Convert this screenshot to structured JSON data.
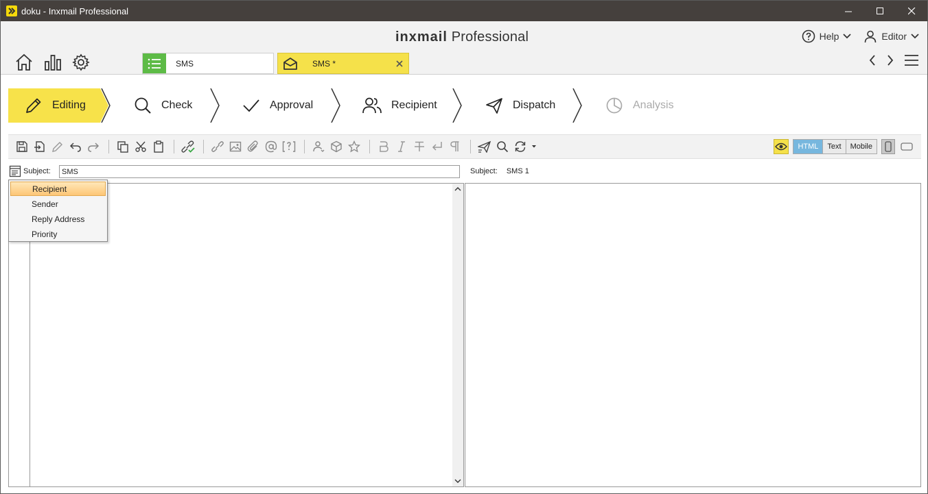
{
  "window": {
    "title": "doku - Inxmail Professional"
  },
  "header": {
    "brand_bold": "inxmail",
    "brand_rest": "Professional",
    "help_label": "Help",
    "user_label": "Editor"
  },
  "tabs": [
    {
      "label": "SMS",
      "icon": "list-icon"
    },
    {
      "label": "SMS *",
      "icon": "mail-open-icon"
    }
  ],
  "steps": [
    {
      "label": "Editing",
      "icon": "pencil-icon",
      "state": "active"
    },
    {
      "label": "Check",
      "icon": "search-icon",
      "state": "normal"
    },
    {
      "label": "Approval",
      "icon": "check-icon",
      "state": "normal"
    },
    {
      "label": "Recipient",
      "icon": "people-icon",
      "state": "normal"
    },
    {
      "label": "Dispatch",
      "icon": "paper-plane-icon",
      "state": "normal"
    },
    {
      "label": "Analysis",
      "icon": "pie-chart-icon",
      "state": "disabled"
    }
  ],
  "toolbar": {
    "view_modes": [
      "HTML",
      "Text",
      "Mobile"
    ],
    "active_view": "HTML"
  },
  "editor": {
    "subject_label": "Subject:",
    "subject_value": "SMS"
  },
  "preview": {
    "subject_label": "Subject:",
    "subject_value": "SMS 1"
  },
  "menu": {
    "items": [
      "Recipient",
      "Sender",
      "Reply Address",
      "Priority"
    ],
    "highlighted": "Recipient"
  },
  "colors": {
    "accent_yellow": "#f7e24a",
    "list_green": "#5dbb46",
    "titlebar": "#45403d",
    "view_active": "#77b7de"
  }
}
